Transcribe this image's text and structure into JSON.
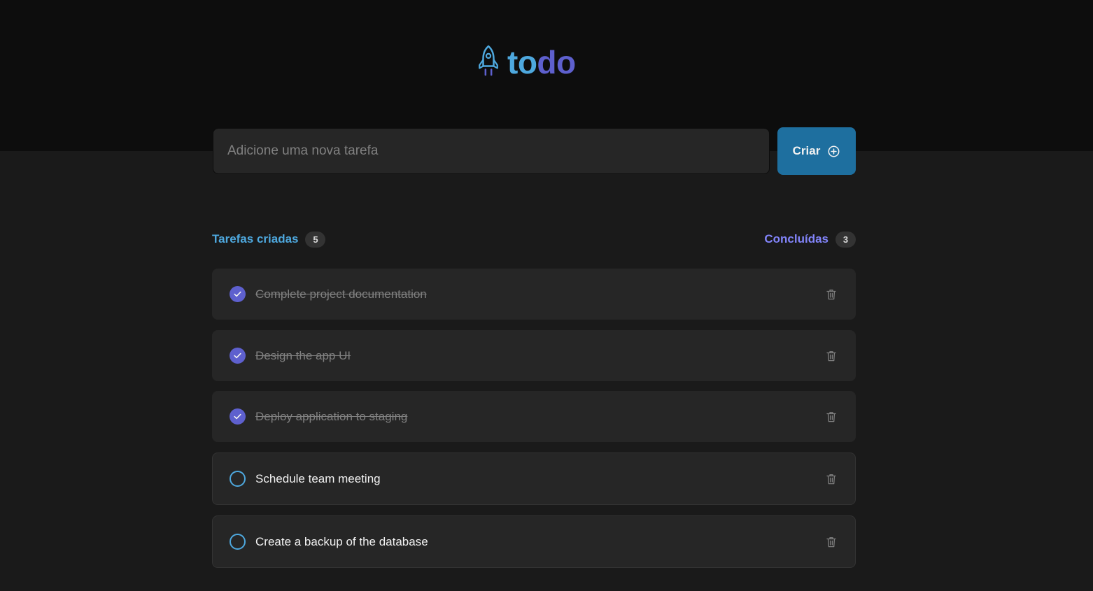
{
  "app": {
    "logo_to": "to",
    "logo_do": "do",
    "logo_icon": "rocket-icon"
  },
  "new_task": {
    "placeholder": "Adicione uma nova tarefa",
    "value": ""
  },
  "create_button": {
    "label": "Criar",
    "icon": "plus-circle-icon"
  },
  "summary": {
    "created_label": "Tarefas criadas",
    "created_count": "5",
    "done_label": "Concluídas",
    "done_count": "3"
  },
  "tasks": [
    {
      "text": "Complete project documentation",
      "completed": true
    },
    {
      "text": "Design the app UI",
      "completed": true
    },
    {
      "text": "Deploy application to staging",
      "completed": true
    },
    {
      "text": "Schedule team meeting",
      "completed": false
    },
    {
      "text": "Create a backup of the database",
      "completed": false
    }
  ],
  "colors": {
    "blue": "#4ea8de",
    "blue_dark": "#1e6f9f",
    "purple": "#5e60ce",
    "purple_light": "#8284fa",
    "gray_100": "#f2f2f2",
    "gray_300": "#808080",
    "gray_500": "#262626",
    "gray_700": "#0d0d0d"
  }
}
